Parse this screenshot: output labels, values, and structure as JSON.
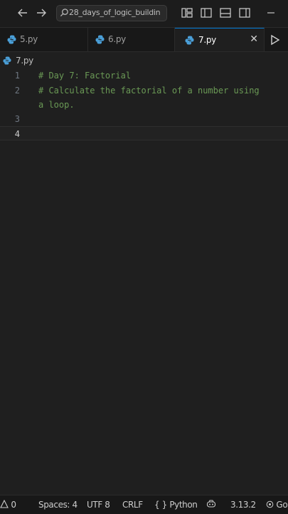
{
  "titlebar": {
    "back_icon": "arrow-left-icon",
    "forward_icon": "arrow-right-icon",
    "search_text": "28_days_of_logic_buildin",
    "minimize_icon": "minimize-icon"
  },
  "tabs": [
    {
      "label": "5.py",
      "active": false
    },
    {
      "label": "6.py",
      "active": false
    },
    {
      "label": "7.py",
      "active": true,
      "close": "✕"
    }
  ],
  "breadcrumb": {
    "file": "7.py"
  },
  "editor": {
    "lines": [
      {
        "number": "1",
        "text": "# Day 7: Factorial"
      },
      {
        "number": "2",
        "text": "# Calculate the factorial of a number using"
      },
      {
        "number": "",
        "text": "a loop."
      },
      {
        "number": "3",
        "text": ""
      },
      {
        "number": "4",
        "text": ""
      }
    ],
    "comment_color": "#6a9955",
    "current_line": "4"
  },
  "statusbar": {
    "warnings": "0",
    "spaces": "Spaces: 4",
    "encoding": "UTF 8",
    "eol": "CRLF",
    "language": "Python",
    "version": "3.13.2",
    "go_live": "Go"
  },
  "colors": {
    "accent": "#0078d4",
    "python_icon": "#4a9fd8"
  }
}
